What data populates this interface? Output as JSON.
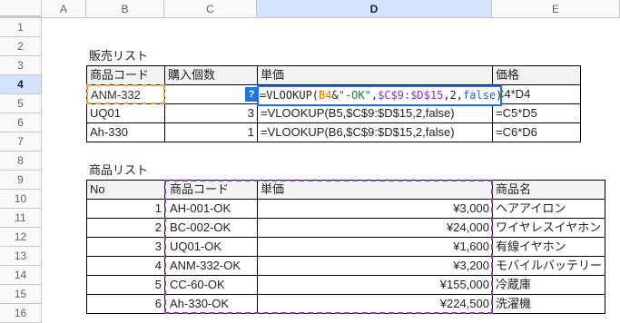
{
  "columns": [
    "A",
    "B",
    "C",
    "D",
    "E"
  ],
  "rows": [
    "1",
    "2",
    "3",
    "4",
    "5",
    "6",
    "7",
    "8",
    "9",
    "10",
    "11",
    "12",
    "13",
    "14",
    "15",
    "16"
  ],
  "selected": {
    "column": "D",
    "row": "4"
  },
  "sales": {
    "title": "販売リスト",
    "headers": [
      "商品コード",
      "購入個数",
      "単価",
      "価格"
    ],
    "rows": [
      {
        "code": "ANM-332",
        "qty": "",
        "price": "=VLOOKUP(B4&\"-OK\",$C$9:$D$15,2,false)",
        "total": "C4*D4"
      },
      {
        "code": "UQ01",
        "qty": "3",
        "price": "=VLOOKUP(B5,$C$9:$D$15,2,false)",
        "total": "=C5*D5"
      },
      {
        "code": "Ah-330",
        "qty": "1",
        "price": "=VLOOKUP(B6,$C$9:$D$15,2,false)",
        "total": "=C6*D6"
      }
    ]
  },
  "editor": {
    "help": "?",
    "tokens": [
      "=VLOOKUP(",
      "B4",
      "&",
      "\"-OK\"",
      ",",
      "$C$9:$D$15",
      ",2,",
      "false",
      ")"
    ]
  },
  "products": {
    "title": "商品リスト",
    "headers": [
      "No",
      "商品コード",
      "単価",
      "商品名"
    ],
    "rows": [
      {
        "no": "1",
        "code": "AH-001-OK",
        "price": "¥3,000",
        "name": "ヘアアイロン"
      },
      {
        "no": "2",
        "code": "BC-002-OK",
        "price": "¥24,000",
        "name": "ワイヤレスイヤホン"
      },
      {
        "no": "3",
        "code": "UQ01-OK",
        "price": "¥1,600",
        "name": "有線イヤホン"
      },
      {
        "no": "4",
        "code": "ANM-332-OK",
        "price": "¥3,200",
        "name": "モバイルバッテリー"
      },
      {
        "no": "5",
        "code": "CC-60-OK",
        "price": "¥155,000",
        "name": "冷蔵庫"
      },
      {
        "no": "6",
        "code": "Ah-330-OK",
        "price": "¥224,500",
        "name": "洗濯機"
      }
    ]
  }
}
